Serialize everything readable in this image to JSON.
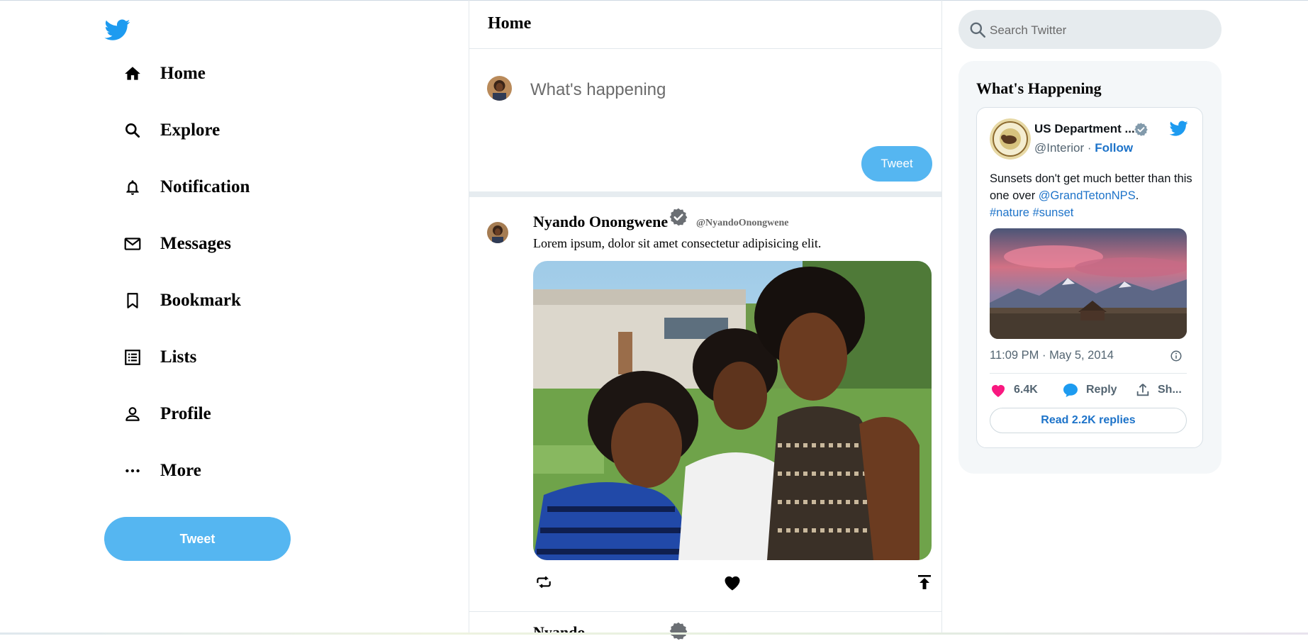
{
  "sidebar": {
    "logo_icon": "twitter-bird-icon",
    "items": [
      {
        "label": "Home",
        "icon": "home-icon"
      },
      {
        "label": "Explore",
        "icon": "search-icon"
      },
      {
        "label": "Notification",
        "icon": "bell-icon"
      },
      {
        "label": "Messages",
        "icon": "mail-icon"
      },
      {
        "label": "Bookmark",
        "icon": "bookmark-icon"
      },
      {
        "label": "Lists",
        "icon": "list-icon"
      },
      {
        "label": "Profile",
        "icon": "person-icon"
      },
      {
        "label": "More",
        "icon": "more-dots-icon"
      }
    ],
    "tweet_button": "Tweet"
  },
  "feed": {
    "title": "Home",
    "composer": {
      "placeholder": "What's happening",
      "tweet_button": "Tweet"
    },
    "post": {
      "name": "Nyando Onongwene",
      "handle": "@NyandoOnongwene",
      "text": "Lorem ipsum, dolor sit amet consectetur adipisicing elit.",
      "actions": [
        "retweet-icon",
        "heart-icon",
        "share-upload-icon"
      ]
    },
    "next_post_name": "Nyando Onongwene"
  },
  "right": {
    "search_placeholder": "Search Twitter",
    "happening_title": "What's Happening",
    "card": {
      "name": "US Department ...",
      "handle": "@Interior",
      "separator": " · ",
      "follow": "Follow",
      "text": "Sunsets don't get much better than this one over ",
      "mention": "@GrandTetonNPS",
      "period": ".",
      "hashtag1": "#nature",
      "hashtag2": "#sunset",
      "time": "11:09 PM · May 5, 2014",
      "likes": "6.4K",
      "reply": "Reply",
      "share": "Sh...",
      "read_replies": "Read 2.2K replies"
    }
  },
  "colors": {
    "accent": "#55b6f1",
    "twitter_blue": "#1d9bf0",
    "link": "#1d73c9",
    "like_pink": "#f91880"
  }
}
